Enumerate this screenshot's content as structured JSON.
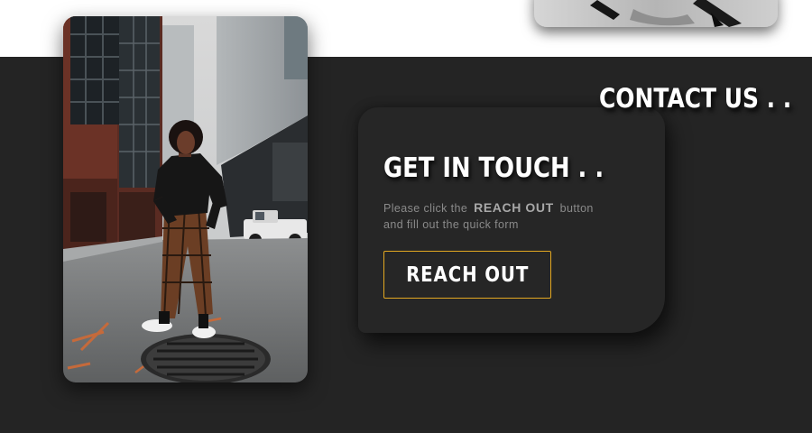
{
  "contact": {
    "title": "CONTACT US . ."
  },
  "touch_card": {
    "heading": "GET IN TOUCH . .",
    "body_prefix": "Please click the",
    "body_emphasis": "REACH OUT",
    "body_suffix": "button",
    "body_line2": "and fill out the quick form",
    "button_label": "REACH OUT"
  },
  "colors": {
    "dark_background": "#242424",
    "card_background": "#262626",
    "button_border": "#e3a821",
    "text_primary": "#ffffff",
    "text_muted": "#8a8a8a"
  }
}
